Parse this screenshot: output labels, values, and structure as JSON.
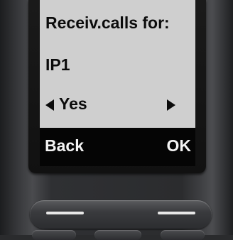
{
  "screen": {
    "title": "Receiv.calls for:",
    "connection": "IP1",
    "selector": {
      "value": "Yes",
      "left_icon": "triangle-left-icon",
      "right_icon": "triangle-right-icon"
    },
    "softkeys": {
      "left_label": "Back",
      "right_label": "OK"
    }
  },
  "colors": {
    "display_background": "#cfcfcf",
    "display_text": "#0b0b0b",
    "softkey_bar": "#050505",
    "softkey_text": "#f4f4f4",
    "housing": "#2b2c2e"
  }
}
